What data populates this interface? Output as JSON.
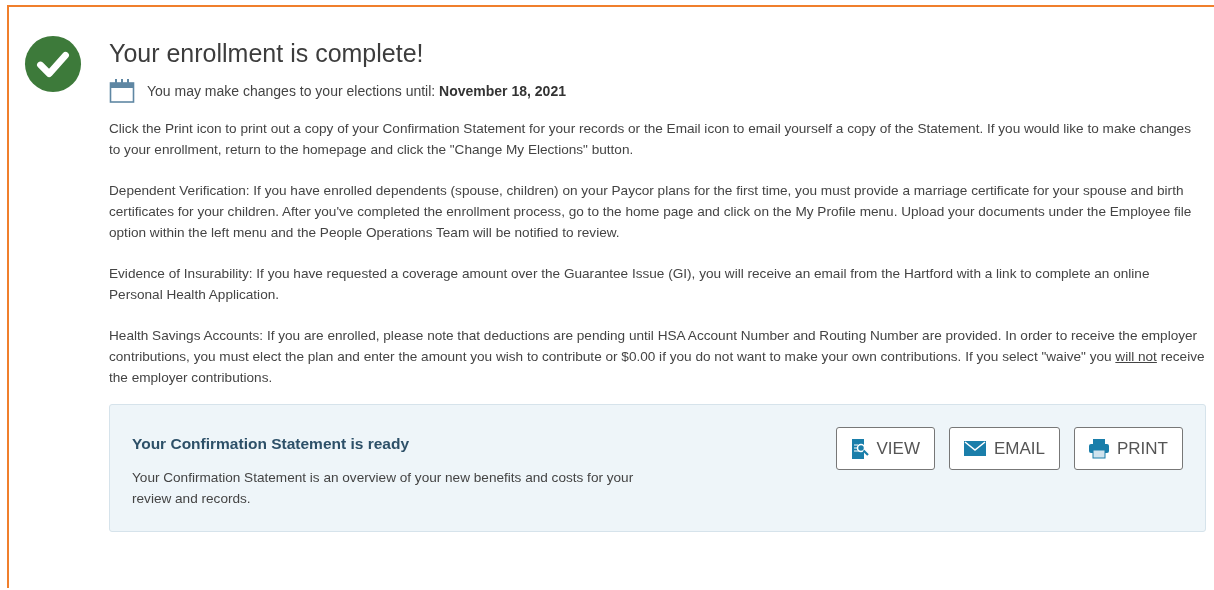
{
  "title": "Your enrollment is complete!",
  "deadline": {
    "label": "You may make changes to your elections until:",
    "date": "November 18, 2021"
  },
  "paragraphs": [
    {
      "text": "Click the Print icon to print out a copy of your Confirmation Statement for your records or the Email icon to email yourself a copy of the Statement. If you would like to make changes to your enrollment, return to the homepage and click the \"Change My Elections\" button."
    },
    {
      "text": "Dependent Verification: If you have enrolled dependents (spouse, children) on your Paycor plans for the first time, you must provide a marriage certificate for your spouse and birth certificates for your children. After you've completed the enrollment process, go to the home page and click on the My Profile menu. Upload your documents under the Employee file option within the left menu and the People Operations Team will be notified to review."
    },
    {
      "text": "Evidence of Insurability: If you have requested a coverage amount over the Guarantee Issue (GI), you will receive an email from the Hartford with a link to complete an online Personal Health Application."
    },
    {
      "text": "Health Savings Accounts: If you are enrolled, please note that deductions are pending until HSA Account Number and Routing Number are provided. In order to receive the employer contributions, you must elect the plan and enter the amount you wish to contribute or $0.00 if you do not want to make your own contributions. If you select \"waive\" you ",
      "underlined": "will not",
      "after": " receive the employer contributions."
    }
  ],
  "statement": {
    "title": "Your Confirmation Statement is ready",
    "description": "Your Confirmation Statement is an overview of your new benefits and costs for your review and records.",
    "buttons": [
      {
        "kind": "view",
        "label": "VIEW"
      },
      {
        "kind": "email",
        "label": "EMAIL"
      },
      {
        "kind": "print",
        "label": "PRINT"
      }
    ]
  }
}
